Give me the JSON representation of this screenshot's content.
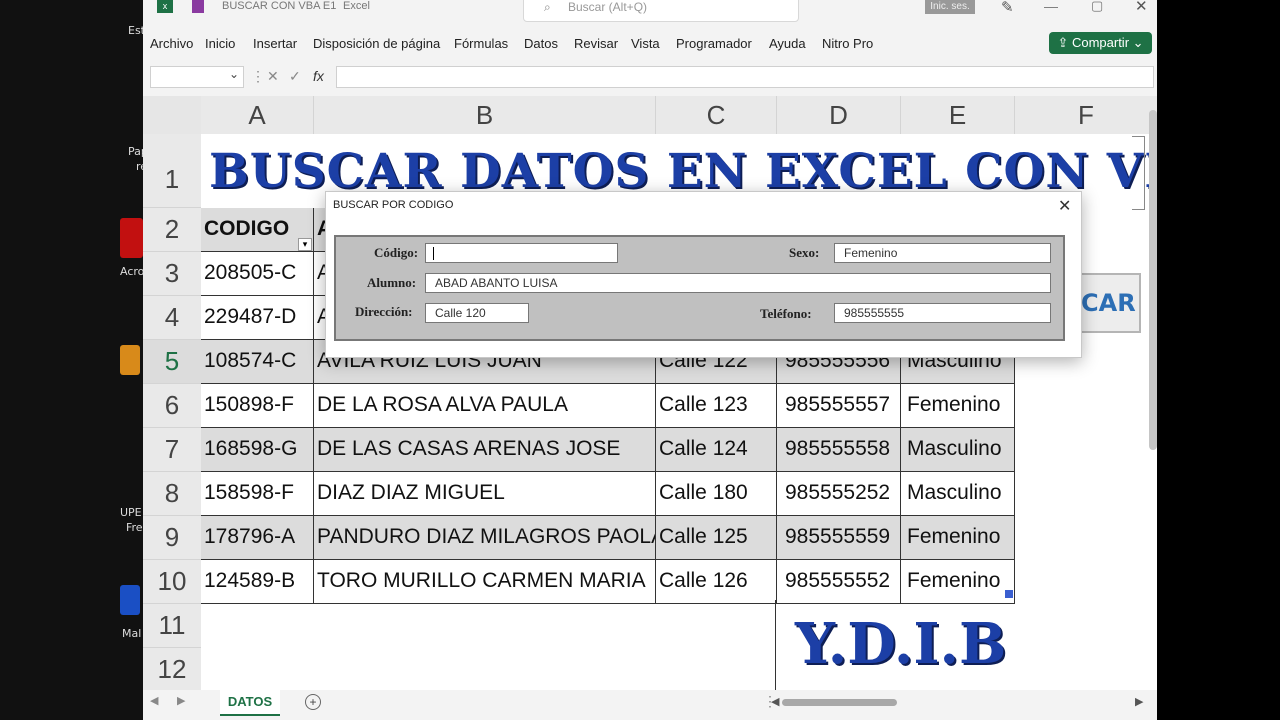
{
  "window": {
    "title": "BUSCAR CON VBA E1",
    "app": "Excel",
    "search_placeholder": "Buscar (Alt+Q)",
    "signin": "Inic. ses."
  },
  "ribbon": {
    "tabs": [
      "Archivo",
      "Inicio",
      "Insertar",
      "Disposición de página",
      "Fórmulas",
      "Datos",
      "Revisar",
      "Vista",
      "Programador",
      "Ayuda",
      "Nitro Pro"
    ],
    "share_label": "Compartir"
  },
  "formula_bar": {
    "fx_label": "fx",
    "value": ""
  },
  "sheet": {
    "columns": [
      "A",
      "B",
      "C",
      "D",
      "E",
      "F"
    ],
    "row_numbers": [
      "1",
      "2",
      "3",
      "4",
      "5",
      "6",
      "7",
      "8",
      "9",
      "10",
      "11",
      "12"
    ],
    "banner": "BUSCAR DATOS EN EXCEL CON VBA",
    "header_codigo": "CODIGO",
    "header_b_partial": "A",
    "row3_code": "208505-C",
    "row3_b": "A",
    "row4_code": "229487-D",
    "row4_b": "A",
    "rows": [
      {
        "codigo": "108574-C",
        "alumno": "AVILA RUIZ LUIS JUAN",
        "direccion": "Calle 122",
        "telefono": "985555556",
        "sexo": "Masculino"
      },
      {
        "codigo": "150898-F",
        "alumno": "DE LA ROSA ALVA PAULA",
        "direccion": "Calle 123",
        "telefono": "985555557",
        "sexo": "Femenino"
      },
      {
        "codigo": "168598-G",
        "alumno": "DE LAS CASAS ARENAS JOSE",
        "direccion": "Calle 124",
        "telefono": "985555558",
        "sexo": "Masculino"
      },
      {
        "codigo": "158598-F",
        "alumno": "DIAZ DIAZ MIGUEL",
        "direccion": "Calle 180",
        "telefono": "985555252",
        "sexo": "Masculino"
      },
      {
        "codigo": "178796-A",
        "alumno": "PANDURO DIAZ MILAGROS PAOLA",
        "direccion": "Calle 125",
        "telefono": "985555559",
        "sexo": "Femenino"
      },
      {
        "codigo": "124589-B",
        "alumno": "TORO MURILLO CARMEN MARIA",
        "direccion": "Calle 126",
        "telefono": "985555552",
        "sexo": "Femenino"
      }
    ],
    "button_partial_label": "CAR",
    "signature": "Y.D.I.B",
    "sheet_tab": "DATOS"
  },
  "dialog": {
    "title": "BUSCAR POR CODIGO",
    "codigo_label": "Código:",
    "codigo_value": "",
    "sexo_label": "Sexo:",
    "sexo_value": "Femenino",
    "alumno_label": "Alumno:",
    "alumno_value": "ABAD ABANTO LUISA",
    "direccion_label": "Dirección:",
    "direccion_value": "Calle 120",
    "telefono_label": "Teléfono:",
    "telefono_value": "985555555"
  },
  "desktop_labels": [
    "Est",
    "Pap",
    "re",
    "Acro",
    "UPE",
    "Fre",
    "Mal"
  ],
  "colors": {
    "excel_green": "#1e7145",
    "banner_blue": "#1c3fa6",
    "zebra_gray": "#dcdcdc"
  }
}
